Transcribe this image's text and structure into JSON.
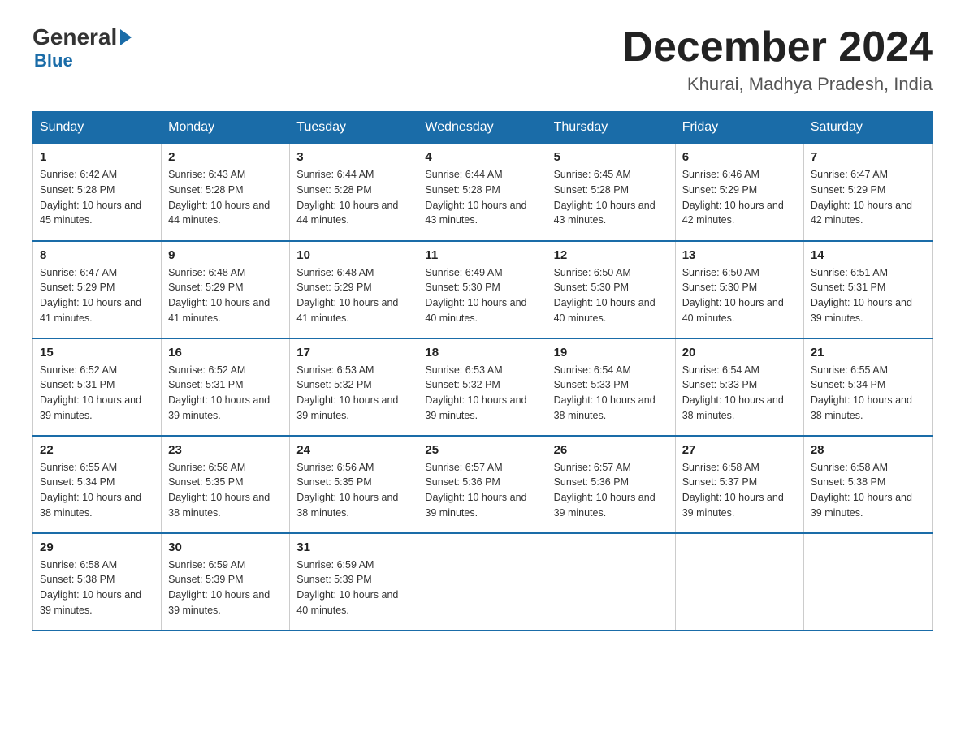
{
  "logo": {
    "general": "General",
    "blue": "Blue"
  },
  "title": "December 2024",
  "location": "Khurai, Madhya Pradesh, India",
  "weekdays": [
    "Sunday",
    "Monday",
    "Tuesday",
    "Wednesday",
    "Thursday",
    "Friday",
    "Saturday"
  ],
  "weeks": [
    [
      {
        "day": "1",
        "sunrise": "6:42 AM",
        "sunset": "5:28 PM",
        "daylight": "10 hours and 45 minutes."
      },
      {
        "day": "2",
        "sunrise": "6:43 AM",
        "sunset": "5:28 PM",
        "daylight": "10 hours and 44 minutes."
      },
      {
        "day": "3",
        "sunrise": "6:44 AM",
        "sunset": "5:28 PM",
        "daylight": "10 hours and 44 minutes."
      },
      {
        "day": "4",
        "sunrise": "6:44 AM",
        "sunset": "5:28 PM",
        "daylight": "10 hours and 43 minutes."
      },
      {
        "day": "5",
        "sunrise": "6:45 AM",
        "sunset": "5:28 PM",
        "daylight": "10 hours and 43 minutes."
      },
      {
        "day": "6",
        "sunrise": "6:46 AM",
        "sunset": "5:29 PM",
        "daylight": "10 hours and 42 minutes."
      },
      {
        "day": "7",
        "sunrise": "6:47 AM",
        "sunset": "5:29 PM",
        "daylight": "10 hours and 42 minutes."
      }
    ],
    [
      {
        "day": "8",
        "sunrise": "6:47 AM",
        "sunset": "5:29 PM",
        "daylight": "10 hours and 41 minutes."
      },
      {
        "day": "9",
        "sunrise": "6:48 AM",
        "sunset": "5:29 PM",
        "daylight": "10 hours and 41 minutes."
      },
      {
        "day": "10",
        "sunrise": "6:48 AM",
        "sunset": "5:29 PM",
        "daylight": "10 hours and 41 minutes."
      },
      {
        "day": "11",
        "sunrise": "6:49 AM",
        "sunset": "5:30 PM",
        "daylight": "10 hours and 40 minutes."
      },
      {
        "day": "12",
        "sunrise": "6:50 AM",
        "sunset": "5:30 PM",
        "daylight": "10 hours and 40 minutes."
      },
      {
        "day": "13",
        "sunrise": "6:50 AM",
        "sunset": "5:30 PM",
        "daylight": "10 hours and 40 minutes."
      },
      {
        "day": "14",
        "sunrise": "6:51 AM",
        "sunset": "5:31 PM",
        "daylight": "10 hours and 39 minutes."
      }
    ],
    [
      {
        "day": "15",
        "sunrise": "6:52 AM",
        "sunset": "5:31 PM",
        "daylight": "10 hours and 39 minutes."
      },
      {
        "day": "16",
        "sunrise": "6:52 AM",
        "sunset": "5:31 PM",
        "daylight": "10 hours and 39 minutes."
      },
      {
        "day": "17",
        "sunrise": "6:53 AM",
        "sunset": "5:32 PM",
        "daylight": "10 hours and 39 minutes."
      },
      {
        "day": "18",
        "sunrise": "6:53 AM",
        "sunset": "5:32 PM",
        "daylight": "10 hours and 39 minutes."
      },
      {
        "day": "19",
        "sunrise": "6:54 AM",
        "sunset": "5:33 PM",
        "daylight": "10 hours and 38 minutes."
      },
      {
        "day": "20",
        "sunrise": "6:54 AM",
        "sunset": "5:33 PM",
        "daylight": "10 hours and 38 minutes."
      },
      {
        "day": "21",
        "sunrise": "6:55 AM",
        "sunset": "5:34 PM",
        "daylight": "10 hours and 38 minutes."
      }
    ],
    [
      {
        "day": "22",
        "sunrise": "6:55 AM",
        "sunset": "5:34 PM",
        "daylight": "10 hours and 38 minutes."
      },
      {
        "day": "23",
        "sunrise": "6:56 AM",
        "sunset": "5:35 PM",
        "daylight": "10 hours and 38 minutes."
      },
      {
        "day": "24",
        "sunrise": "6:56 AM",
        "sunset": "5:35 PM",
        "daylight": "10 hours and 38 minutes."
      },
      {
        "day": "25",
        "sunrise": "6:57 AM",
        "sunset": "5:36 PM",
        "daylight": "10 hours and 39 minutes."
      },
      {
        "day": "26",
        "sunrise": "6:57 AM",
        "sunset": "5:36 PM",
        "daylight": "10 hours and 39 minutes."
      },
      {
        "day": "27",
        "sunrise": "6:58 AM",
        "sunset": "5:37 PM",
        "daylight": "10 hours and 39 minutes."
      },
      {
        "day": "28",
        "sunrise": "6:58 AM",
        "sunset": "5:38 PM",
        "daylight": "10 hours and 39 minutes."
      }
    ],
    [
      {
        "day": "29",
        "sunrise": "6:58 AM",
        "sunset": "5:38 PM",
        "daylight": "10 hours and 39 minutes."
      },
      {
        "day": "30",
        "sunrise": "6:59 AM",
        "sunset": "5:39 PM",
        "daylight": "10 hours and 39 minutes."
      },
      {
        "day": "31",
        "sunrise": "6:59 AM",
        "sunset": "5:39 PM",
        "daylight": "10 hours and 40 minutes."
      },
      null,
      null,
      null,
      null
    ]
  ]
}
